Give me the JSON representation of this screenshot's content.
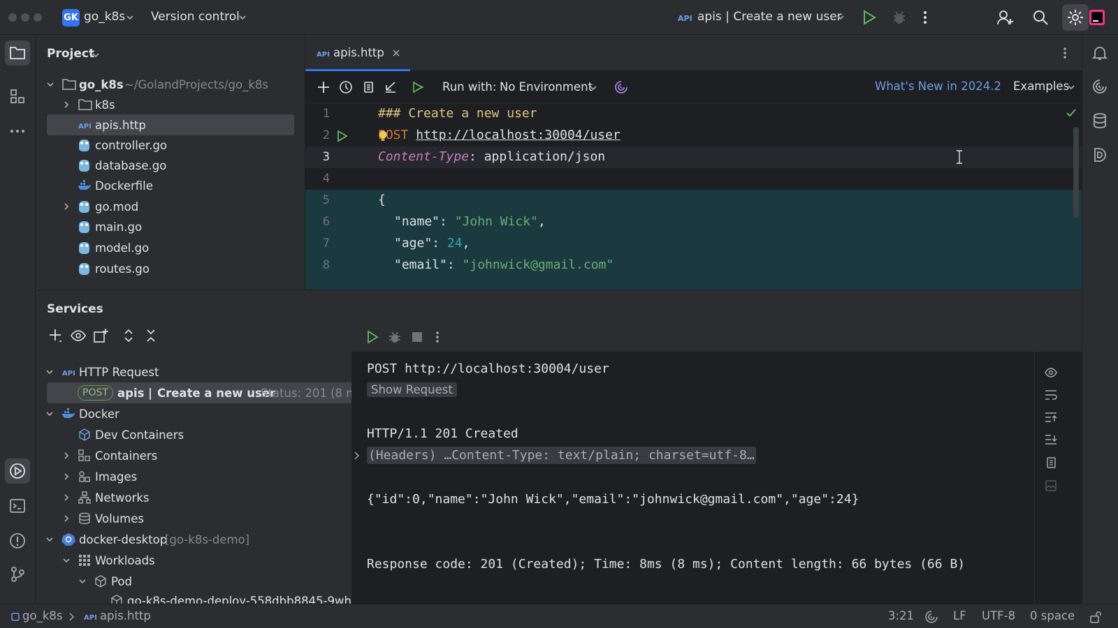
{
  "titlebar": {
    "project_badge": "GK",
    "project_name": "go_k8s",
    "vcs_label": "Version control",
    "run_config": "apis | Create a new user",
    "accent": "#3574f0"
  },
  "left_strip": {
    "top_icons": [
      "folder-icon",
      "structure-icon",
      "more-icon"
    ],
    "bottom_icons": [
      "services-icon",
      "terminal-icon",
      "problems-icon",
      "git-icon"
    ]
  },
  "right_strip": {
    "icons": [
      "bell-icon",
      "ai-assistant-icon",
      "database-icon",
      "docker-d-icon"
    ]
  },
  "project_panel": {
    "title": "Project",
    "root": {
      "name": "go_k8s",
      "path": "~/GolandProjects/go_k8s"
    },
    "items": [
      {
        "label": "k8s",
        "kind": "folder"
      },
      {
        "label": "apis.http",
        "kind": "http"
      },
      {
        "label": "controller.go",
        "kind": "go"
      },
      {
        "label": "database.go",
        "kind": "go"
      },
      {
        "label": "Dockerfile",
        "kind": "docker"
      },
      {
        "label": "go.mod",
        "kind": "go"
      },
      {
        "label": "main.go",
        "kind": "go"
      },
      {
        "label": "model.go",
        "kind": "go"
      },
      {
        "label": "routes.go",
        "kind": "go"
      }
    ]
  },
  "editor": {
    "tab": {
      "badge": "API",
      "label": "apis.http"
    },
    "toolbar": {
      "run_with_label": "Run with:",
      "environment": "No Environment",
      "whats_new": "What's New in 2024.2",
      "examples": "Examples"
    },
    "lines": [
      {
        "n": "1",
        "text": "### Create a new user"
      },
      {
        "n": "2",
        "method": "POST",
        "url": "http://localhost:30004/user"
      },
      {
        "n": "3",
        "header_name": "Content-Type",
        "header_value": ": application/json"
      },
      {
        "n": "4"
      },
      {
        "n": "5",
        "text": "{"
      },
      {
        "n": "6",
        "key": "\"name\"",
        "value": "\"John Wick\"",
        "tail": ","
      },
      {
        "n": "7",
        "key": "\"age\"",
        "value": "24",
        "tail": ","
      },
      {
        "n": "8",
        "key": "\"email\"",
        "value": "\"johnwick@gmail.com\"",
        "tail": ""
      }
    ]
  },
  "services": {
    "title": "Services",
    "tree": {
      "http_request": "HTTP Request",
      "request_item": {
        "method": "POST",
        "name": "apis",
        "separator": "|",
        "title": "Create a new user",
        "status": "Status: 201 (8 m"
      },
      "docker": "Docker",
      "dev_containers": "Dev Containers",
      "containers": "Containers",
      "images": "Images",
      "networks": "Networks",
      "volumes": "Volumes",
      "docker_desktop": "docker-desktop",
      "docker_desktop_ctx": "[go-k8s-demo]",
      "workloads": "Workloads",
      "pod": "Pod",
      "pod_item": "go-k8s-demo-deploy-558dbb8845-9wh!"
    },
    "output": {
      "request_line": "POST http://localhost:30004/user",
      "show_request": "Show Request",
      "status_line": "HTTP/1.1 201 Created",
      "headers_line": "(Headers) …Content-Type: text/plain; charset=utf-8…",
      "body": "{\"id\":0,\"name\":\"John Wick\",\"email\":\"johnwick@gmail.com\",\"age\":24}",
      "summary": "Response code: 201 (Created); Time: 8ms (8 ms); Content length: 66 bytes (66 B)"
    }
  },
  "statusbar": {
    "project": "go_k8s",
    "file": "apis.http",
    "position": "3:21",
    "line_sep": "LF",
    "encoding": "UTF-8",
    "indent": "0 space"
  }
}
